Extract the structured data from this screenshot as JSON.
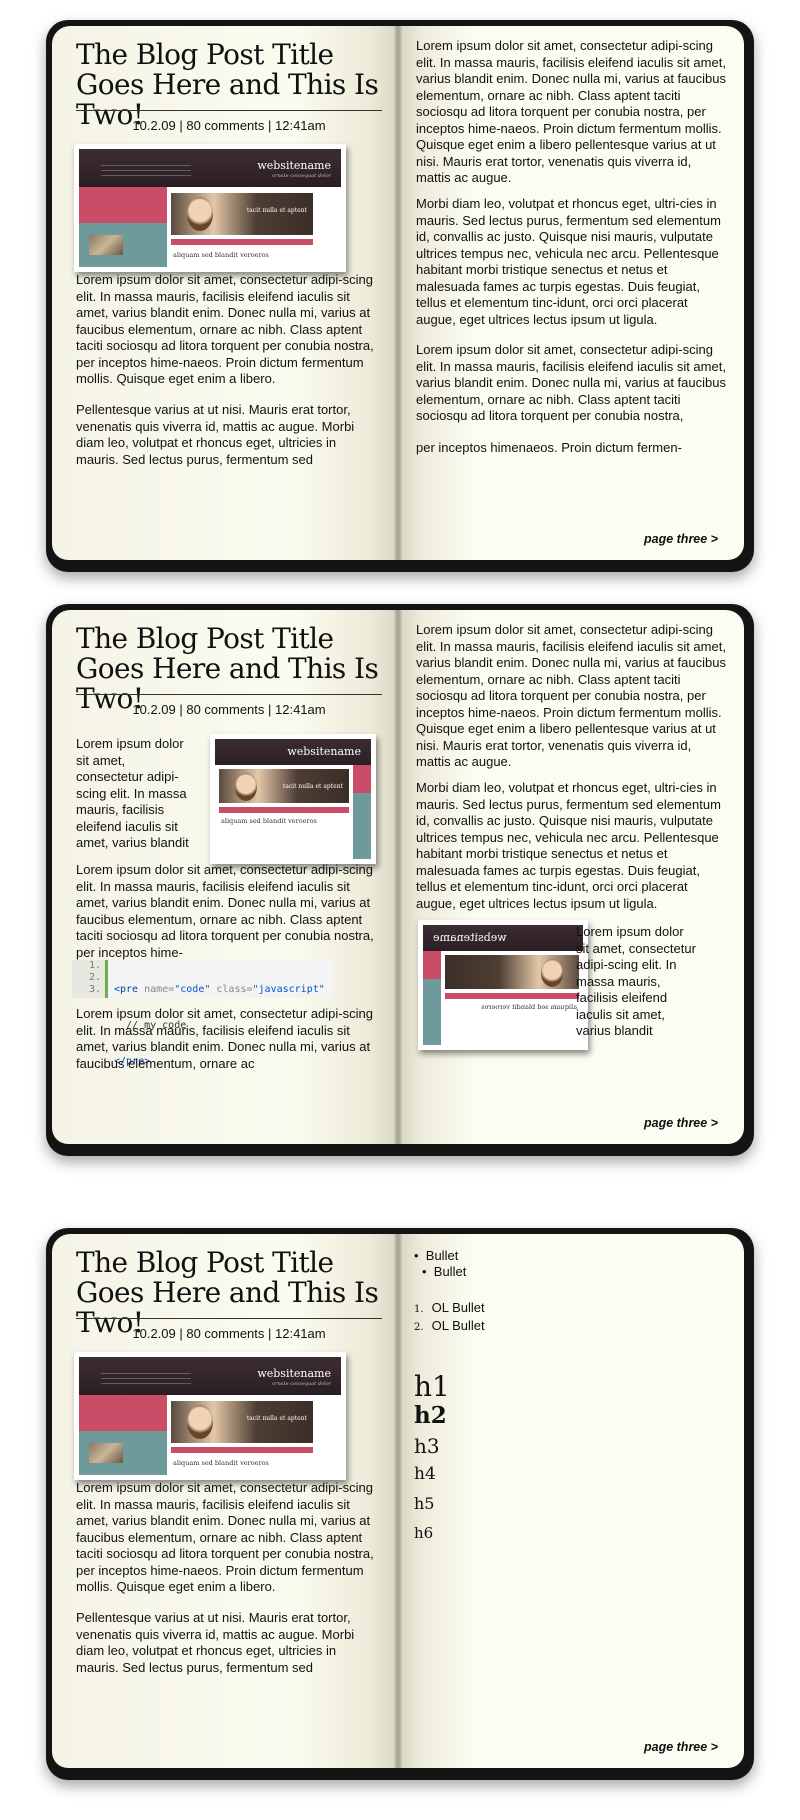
{
  "post": {
    "title": "The Blog Post Title Goes Here and This Is Two!",
    "meta": "10.2.09  |  80 comments  | 12:41am"
  },
  "site_preview": {
    "name": "websitename",
    "slogan": "ornate consequat dolor",
    "hero_text": "tacit nulla et aptent",
    "caption": "aliquam sed blandit veroeros"
  },
  "pager": "page three >",
  "book1": {
    "left_p1": "Lorem ipsum dolor sit amet, consectetur adipi-scing elit. In massa mauris, facilisis eleifend iaculis sit amet, varius blandit enim. Donec nulla mi, varius at faucibus elementum, ornare ac nibh. Class aptent taciti sociosqu ad litora torquent per conubia nostra, per inceptos hime-naeos. Proin dictum fermentum mollis. Quisque eget enim a libero.",
    "left_p2": "Pellentesque varius at ut nisi. Mauris erat tortor, venenatis quis viverra id, mattis ac augue. Morbi diam leo, volutpat et rhoncus eget, ultricies in mauris. Sed lectus purus, fermentum sed",
    "right_p1": "Lorem ipsum dolor sit amet, consectetur adipi-scing elit. In massa mauris, facilisis eleifend iaculis sit amet, varius blandit enim. Donec nulla mi, varius at faucibus elementum, ornare ac nibh. Class aptent taciti sociosqu ad litora torquent per conubia nostra, per inceptos hime-naeos. Proin dictum fermentum mollis. Quisque eget enim a libero pellentesque varius at ut nisi. Mauris erat tortor, venenatis quis viverra id, mattis ac augue.",
    "right_p2": "Morbi diam leo, volutpat et rhoncus eget, ultri-cies in mauris. Sed lectus purus, fermentum sed elementum id, convallis ac justo. Quisque nisi mauris, vulputate ultrices tempus nec, vehicula nec arcu. Pellentesque habitant morbi tristique senectus et netus et malesuada fames ac turpis egestas. Duis feugiat, tellus et elementum tinc-idunt, orci orci placerat augue, eget ultrices lectus ipsum ut ligula.",
    "right_p3": "Lorem ipsum dolor sit amet, consectetur adipi-scing elit. In massa mauris, facilisis eleifend iaculis sit amet, varius blandit enim. Donec nulla mi, varius at faucibus elementum, ornare ac nibh. Class aptent taciti sociosqu ad litora torquent per conubia nostra,",
    "right_p4": "per inceptos himenaeos. Proin dictum fermen-"
  },
  "book2": {
    "float_text": "Lorem ipsum dolor sit amet, consectetur adipi-scing elit. In massa mauris, facilisis eleifend iaculis sit amet, varius blandit",
    "left_p1": "Lorem ipsum dolor sit amet, consectetur adipi-scing elit. In massa mauris, facilisis eleifend iaculis sit amet, varius blandit enim. Donec nulla mi, varius at faucibus elementum, ornare ac nibh. Class aptent taciti sociosqu ad litora torquent per conubia nostra, per inceptos hime-",
    "code": {
      "line_numbers": [
        "1.",
        "2.",
        "3."
      ],
      "line1_tag": "<pre",
      "line1_attr1": "name=",
      "line1_val1": "\"code\"",
      "line1_attr2": "class=",
      "line1_val2": "\"javascript\"",
      "line2": "  // my code",
      "line3": "</pre>"
    },
    "left_p2": "Lorem ipsum dolor sit amet, consectetur adipi-scing elit. In massa mauris, facilisis eleifend iaculis sit amet, varius blandit enim. Donec nulla mi, varius at faucibus elementum, ornare ac",
    "right_p1": "Lorem ipsum dolor sit amet, consectetur adipi-scing elit. In massa mauris, facilisis eleifend iaculis sit amet, varius blandit enim. Donec nulla mi, varius at faucibus elementum, ornare ac nibh. Class aptent taciti sociosqu ad litora torquent per conubia nostra, per inceptos hime-naeos. Proin dictum fermentum mollis. Quisque eget enim a libero pellentesque varius at ut nisi. Mauris erat tortor, venenatis quis viverra id, mattis ac augue.",
    "right_p2": "Morbi diam leo, volutpat et rhoncus eget, ultri-cies in mauris. Sed lectus purus, fermentum sed elementum id, convallis ac justo. Quisque nisi mauris, vulputate ultrices tempus nec, vehicula nec arcu. Pellentesque habitant morbi tristique senectus et netus et malesuada fames ac turpis egestas. Duis feugiat, tellus et elementum tinc-idunt, orci orci placerat augue, eget ultrices lectus ipsum ut ligula.",
    "right_float_text": "Lorem ipsum dolor sit amet, consectetur adipi-scing elit. In massa mauris, facilisis eleifend iaculis sit amet, varius blandit"
  },
  "book3": {
    "left_p1": "Lorem ipsum dolor sit amet, consectetur adipi-scing elit. In massa mauris, facilisis eleifend iaculis sit amet, varius blandit enim. Donec nulla mi, varius at faucibus elementum, ornare ac nibh. Class aptent taciti sociosqu ad litora torquent per conubia nostra, per inceptos hime-naeos. Proin dictum fermentum mollis. Quisque eget enim a libero.",
    "left_p2": "Pellentesque varius at ut nisi. Mauris erat tortor, venenatis quis viverra id, mattis ac augue. Morbi diam leo, volutpat et rhoncus eget, ultricies in mauris. Sed lectus purus, fermentum sed",
    "bullet1": "Bullet",
    "bullet2": "Bullet",
    "ol_nums": [
      "1.",
      "2."
    ],
    "ol1": "OL Bullet",
    "ol2": "OL Bullet",
    "headings": [
      "h1",
      "h2",
      "h3",
      "h4",
      "h5",
      "h6"
    ]
  }
}
